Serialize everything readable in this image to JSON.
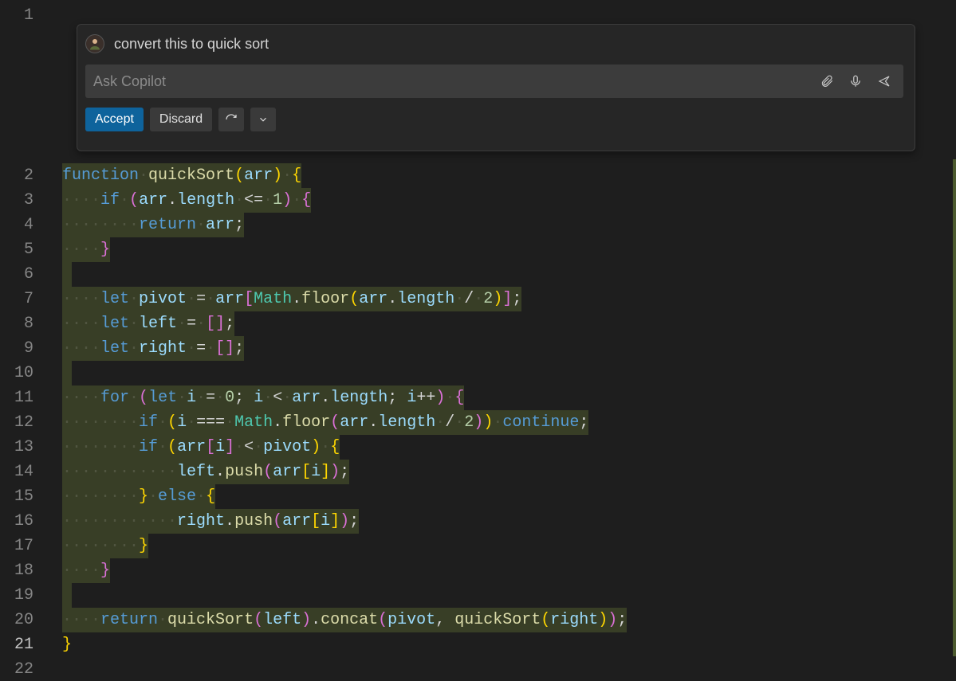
{
  "copilot": {
    "prompt_title": "convert this to quick sort",
    "input_placeholder": "Ask Copilot",
    "accept_label": "Accept",
    "discard_label": "Discard"
  },
  "gutter": {
    "numbers": [
      "1",
      "2",
      "3",
      "4",
      "5",
      "6",
      "7",
      "8",
      "9",
      "10",
      "11",
      "12",
      "13",
      "14",
      "15",
      "16",
      "17",
      "18",
      "19",
      "20",
      "21",
      "22"
    ],
    "active_line": "21"
  },
  "code": {
    "lines": [
      {
        "n": 2,
        "segments": [
          [
            "kw",
            "function"
          ],
          [
            "plain",
            " "
          ],
          [
            "fn",
            "quickSort"
          ],
          [
            "bpun",
            "("
          ],
          [
            "id",
            "arr"
          ],
          [
            "bpun",
            ")"
          ],
          [
            "plain",
            " "
          ],
          [
            "bpun",
            "{"
          ]
        ]
      },
      {
        "n": 3,
        "indent": 4,
        "segments": [
          [
            "kw",
            "if"
          ],
          [
            "plain",
            " "
          ],
          [
            "ppun",
            "("
          ],
          [
            "id",
            "arr"
          ],
          [
            "plain",
            "."
          ],
          [
            "id",
            "length"
          ],
          [
            "plain",
            " "
          ],
          [
            "op",
            "<="
          ],
          [
            "plain",
            " "
          ],
          [
            "num",
            "1"
          ],
          [
            "ppun",
            ")"
          ],
          [
            "plain",
            " "
          ],
          [
            "ppun",
            "{"
          ]
        ]
      },
      {
        "n": 4,
        "indent": 8,
        "segments": [
          [
            "kw",
            "return"
          ],
          [
            "plain",
            " "
          ],
          [
            "id",
            "arr"
          ],
          [
            "plain",
            ";"
          ]
        ]
      },
      {
        "n": 5,
        "indent": 4,
        "segments": [
          [
            "ppun",
            "}"
          ]
        ]
      },
      {
        "n": 6,
        "indent": 0,
        "segments": [],
        "blank": true
      },
      {
        "n": 7,
        "indent": 4,
        "segments": [
          [
            "kw",
            "let"
          ],
          [
            "plain",
            " "
          ],
          [
            "id",
            "pivot"
          ],
          [
            "plain",
            " "
          ],
          [
            "op",
            "="
          ],
          [
            "plain",
            " "
          ],
          [
            "id",
            "arr"
          ],
          [
            "ppun",
            "["
          ],
          [
            "cls",
            "Math"
          ],
          [
            "plain",
            "."
          ],
          [
            "fn",
            "floor"
          ],
          [
            "bpun",
            "("
          ],
          [
            "id",
            "arr"
          ],
          [
            "plain",
            "."
          ],
          [
            "id",
            "length"
          ],
          [
            "plain",
            " "
          ],
          [
            "op",
            "/"
          ],
          [
            "plain",
            " "
          ],
          [
            "num",
            "2"
          ],
          [
            "bpun",
            ")"
          ],
          [
            "ppun",
            "]"
          ],
          [
            "plain",
            ";"
          ]
        ]
      },
      {
        "n": 8,
        "indent": 4,
        "segments": [
          [
            "kw",
            "let"
          ],
          [
            "plain",
            " "
          ],
          [
            "id",
            "left"
          ],
          [
            "plain",
            " "
          ],
          [
            "op",
            "="
          ],
          [
            "plain",
            " "
          ],
          [
            "ppun",
            "["
          ],
          [
            "ppun",
            "]"
          ],
          [
            "plain",
            ";"
          ]
        ]
      },
      {
        "n": 9,
        "indent": 4,
        "segments": [
          [
            "kw",
            "let"
          ],
          [
            "plain",
            " "
          ],
          [
            "id",
            "right"
          ],
          [
            "plain",
            " "
          ],
          [
            "op",
            "="
          ],
          [
            "plain",
            " "
          ],
          [
            "ppun",
            "["
          ],
          [
            "ppun",
            "]"
          ],
          [
            "plain",
            ";"
          ]
        ]
      },
      {
        "n": 10,
        "indent": 0,
        "segments": [],
        "blank": true
      },
      {
        "n": 11,
        "indent": 4,
        "segments": [
          [
            "kw",
            "for"
          ],
          [
            "plain",
            " "
          ],
          [
            "ppun",
            "("
          ],
          [
            "kw",
            "let"
          ],
          [
            "plain",
            " "
          ],
          [
            "id",
            "i"
          ],
          [
            "plain",
            " "
          ],
          [
            "op",
            "="
          ],
          [
            "plain",
            " "
          ],
          [
            "num",
            "0"
          ],
          [
            "plain",
            "; "
          ],
          [
            "id",
            "i"
          ],
          [
            "plain",
            " "
          ],
          [
            "op",
            "<"
          ],
          [
            "plain",
            " "
          ],
          [
            "id",
            "arr"
          ],
          [
            "plain",
            "."
          ],
          [
            "id",
            "length"
          ],
          [
            "plain",
            "; "
          ],
          [
            "id",
            "i"
          ],
          [
            "op",
            "++"
          ],
          [
            "ppun",
            ")"
          ],
          [
            "plain",
            " "
          ],
          [
            "ppun",
            "{"
          ]
        ]
      },
      {
        "n": 12,
        "indent": 8,
        "segments": [
          [
            "kw",
            "if"
          ],
          [
            "plain",
            " "
          ],
          [
            "bpun",
            "("
          ],
          [
            "id",
            "i"
          ],
          [
            "plain",
            " "
          ],
          [
            "op",
            "==="
          ],
          [
            "plain",
            " "
          ],
          [
            "cls",
            "Math"
          ],
          [
            "plain",
            "."
          ],
          [
            "fn",
            "floor"
          ],
          [
            "ppun",
            "("
          ],
          [
            "id",
            "arr"
          ],
          [
            "plain",
            "."
          ],
          [
            "id",
            "length"
          ],
          [
            "plain",
            " "
          ],
          [
            "op",
            "/"
          ],
          [
            "plain",
            " "
          ],
          [
            "num",
            "2"
          ],
          [
            "ppun",
            ")"
          ],
          [
            "bpun",
            ")"
          ],
          [
            "plain",
            " "
          ],
          [
            "kw",
            "continue"
          ],
          [
            "plain",
            ";"
          ]
        ]
      },
      {
        "n": 13,
        "indent": 8,
        "segments": [
          [
            "kw",
            "if"
          ],
          [
            "plain",
            " "
          ],
          [
            "bpun",
            "("
          ],
          [
            "id",
            "arr"
          ],
          [
            "ppun",
            "["
          ],
          [
            "id",
            "i"
          ],
          [
            "ppun",
            "]"
          ],
          [
            "plain",
            " "
          ],
          [
            "op",
            "<"
          ],
          [
            "plain",
            " "
          ],
          [
            "id",
            "pivot"
          ],
          [
            "bpun",
            ")"
          ],
          [
            "plain",
            " "
          ],
          [
            "bpun",
            "{"
          ]
        ]
      },
      {
        "n": 14,
        "indent": 12,
        "segments": [
          [
            "id",
            "left"
          ],
          [
            "plain",
            "."
          ],
          [
            "fn",
            "push"
          ],
          [
            "ppun",
            "("
          ],
          [
            "id",
            "arr"
          ],
          [
            "bpun",
            "["
          ],
          [
            "id",
            "i"
          ],
          [
            "bpun",
            "]"
          ],
          [
            "ppun",
            ")"
          ],
          [
            "plain",
            ";"
          ]
        ]
      },
      {
        "n": 15,
        "indent": 8,
        "segments": [
          [
            "bpun",
            "}"
          ],
          [
            "plain",
            " "
          ],
          [
            "kw",
            "else"
          ],
          [
            "plain",
            " "
          ],
          [
            "bpun",
            "{"
          ]
        ]
      },
      {
        "n": 16,
        "indent": 12,
        "segments": [
          [
            "id",
            "right"
          ],
          [
            "plain",
            "."
          ],
          [
            "fn",
            "push"
          ],
          [
            "ppun",
            "("
          ],
          [
            "id",
            "arr"
          ],
          [
            "bpun",
            "["
          ],
          [
            "id",
            "i"
          ],
          [
            "bpun",
            "]"
          ],
          [
            "ppun",
            ")"
          ],
          [
            "plain",
            ";"
          ]
        ]
      },
      {
        "n": 17,
        "indent": 8,
        "segments": [
          [
            "bpun",
            "}"
          ]
        ]
      },
      {
        "n": 18,
        "indent": 4,
        "segments": [
          [
            "ppun",
            "}"
          ]
        ]
      },
      {
        "n": 19,
        "indent": 0,
        "segments": [],
        "blank": true
      },
      {
        "n": 20,
        "indent": 4,
        "segments": [
          [
            "kw",
            "return"
          ],
          [
            "plain",
            " "
          ],
          [
            "fn",
            "quickSort"
          ],
          [
            "ppun",
            "("
          ],
          [
            "id",
            "left"
          ],
          [
            "ppun",
            ")"
          ],
          [
            "plain",
            "."
          ],
          [
            "fn",
            "concat"
          ],
          [
            "ppun",
            "("
          ],
          [
            "id",
            "pivot"
          ],
          [
            "plain",
            ", "
          ],
          [
            "fn",
            "quickSort"
          ],
          [
            "bpun",
            "("
          ],
          [
            "id",
            "right"
          ],
          [
            "bpun",
            ")"
          ],
          [
            "ppun",
            ")"
          ],
          [
            "plain",
            ";"
          ]
        ]
      },
      {
        "n": 21,
        "indent": 0,
        "segments": [
          [
            "bpun",
            "}"
          ]
        ],
        "noDiff": true
      }
    ]
  }
}
